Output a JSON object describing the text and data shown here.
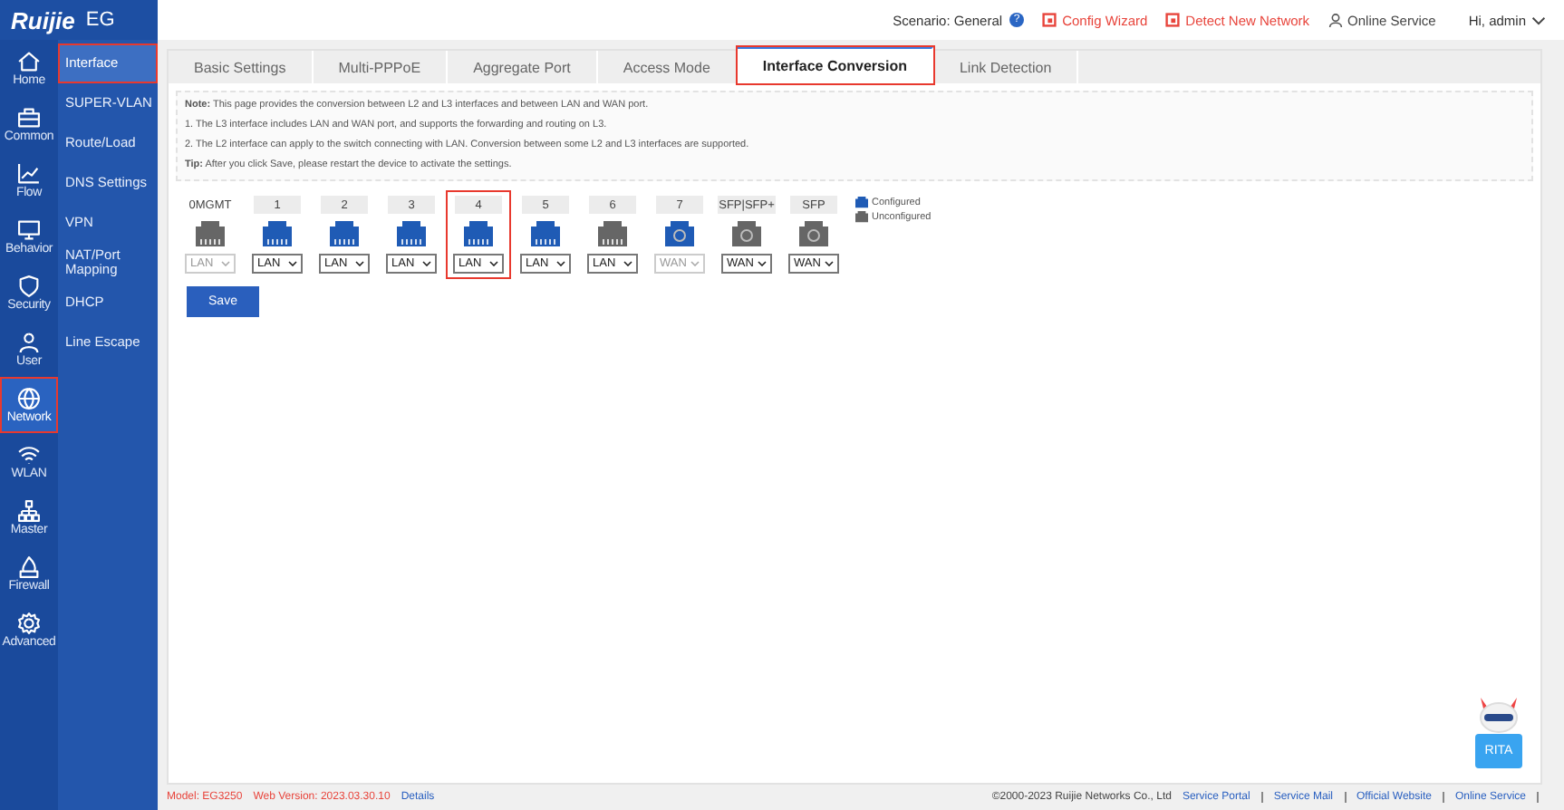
{
  "logo": {
    "brand": "Ruijie",
    "product": "EG"
  },
  "header": {
    "scenario_label": "Scenario:",
    "scenario_value": "General",
    "help": "?",
    "links": [
      {
        "label": "Config Wizard",
        "kind": "alert"
      },
      {
        "label": "Detect New Network",
        "kind": "alert"
      },
      {
        "label": "Online Service",
        "kind": "person"
      }
    ],
    "user": "Hi, admin"
  },
  "rail": [
    {
      "label": "Home",
      "selected": false,
      "highlighted": false
    },
    {
      "label": "Common",
      "selected": false,
      "highlighted": false
    },
    {
      "label": "Flow",
      "selected": false,
      "highlighted": false
    },
    {
      "label": "Behavior",
      "selected": false,
      "highlighted": false
    },
    {
      "label": "Security",
      "selected": false,
      "highlighted": false
    },
    {
      "label": "User",
      "selected": false,
      "highlighted": false
    },
    {
      "label": "Network",
      "selected": true,
      "highlighted": true
    },
    {
      "label": "WLAN",
      "selected": false,
      "highlighted": false
    },
    {
      "label": "Master",
      "selected": false,
      "highlighted": false
    },
    {
      "label": "Firewall",
      "selected": false,
      "highlighted": false
    },
    {
      "label": "Advanced",
      "selected": false,
      "highlighted": false
    }
  ],
  "submenu": [
    {
      "label": "Interface",
      "selected": true,
      "highlighted": true
    },
    {
      "label": "SUPER-VLAN",
      "selected": false,
      "highlighted": false
    },
    {
      "label": "Route/Load",
      "selected": false,
      "highlighted": false
    },
    {
      "label": "DNS Settings",
      "selected": false,
      "highlighted": false
    },
    {
      "label": "VPN",
      "selected": false,
      "highlighted": false
    },
    {
      "label": "NAT/Port Mapping",
      "selected": false,
      "highlighted": false
    },
    {
      "label": "DHCP",
      "selected": false,
      "highlighted": false
    },
    {
      "label": "Line Escape",
      "selected": false,
      "highlighted": false
    }
  ],
  "tabs": [
    {
      "label": "Basic Settings",
      "selected": false,
      "highlighted": false
    },
    {
      "label": "Multi-PPPoE",
      "selected": false,
      "highlighted": false
    },
    {
      "label": "Aggregate Port",
      "selected": false,
      "highlighted": false
    },
    {
      "label": "Access Mode",
      "selected": false,
      "highlighted": false
    },
    {
      "label": "Interface Conversion",
      "selected": true,
      "highlighted": true
    },
    {
      "label": "Link Detection",
      "selected": false,
      "highlighted": false
    }
  ],
  "notes": [
    "**Note:** This page provides the conversion between L2 and L3 interfaces and between LAN and WAN port.",
    "1. The L3 interface includes LAN and WAN port, and supports the forwarding and routing on L3.",
    "2. The L2 interface can apply to the switch connecting with LAN. Conversion between some L2 and L3 interfaces are supported.",
    "**Tip:** After you click Save, please restart the device to activate the settings."
  ],
  "ports": [
    {
      "label": "0MGMT",
      "kind": "rj45",
      "configured": false,
      "value": "LAN",
      "disabled": true
    },
    {
      "label": "1",
      "kind": "rj45",
      "configured": true,
      "value": "LAN",
      "disabled": false
    },
    {
      "label": "2",
      "kind": "rj45",
      "configured": true,
      "value": "LAN",
      "disabled": false
    },
    {
      "label": "3",
      "kind": "rj45",
      "configured": true,
      "value": "LAN",
      "disabled": false
    },
    {
      "label": "4",
      "kind": "rj45",
      "configured": true,
      "value": "LAN",
      "disabled": false,
      "highlighted": true
    },
    {
      "label": "5",
      "kind": "rj45",
      "configured": true,
      "value": "LAN",
      "disabled": false
    },
    {
      "label": "6",
      "kind": "rj45",
      "configured": false,
      "value": "LAN",
      "disabled": false
    },
    {
      "label": "7",
      "kind": "sfp",
      "configured": true,
      "value": "WAN",
      "disabled": true
    },
    {
      "label": "SFP|SFP+",
      "kind": "sfp",
      "configured": false,
      "value": "WAN",
      "disabled": false
    },
    {
      "label": "SFP",
      "kind": "sfp",
      "configured": false,
      "value": "WAN",
      "disabled": false
    }
  ],
  "legend": [
    {
      "label": "Configured",
      "configured": true
    },
    {
      "label": "Unconfigured",
      "configured": false
    }
  ],
  "save_button": "Save",
  "assistant": "RITA",
  "footer": {
    "model_label": "Model:",
    "model": "EG3250",
    "version_label": "Web Version:",
    "version": "2023.03.30.10",
    "details": "Details",
    "copyright": "©2000-2023 Ruijie Networks Co., Ltd",
    "links": [
      "Service Portal",
      "Service Mail",
      "Official Website",
      "Online Service"
    ]
  }
}
